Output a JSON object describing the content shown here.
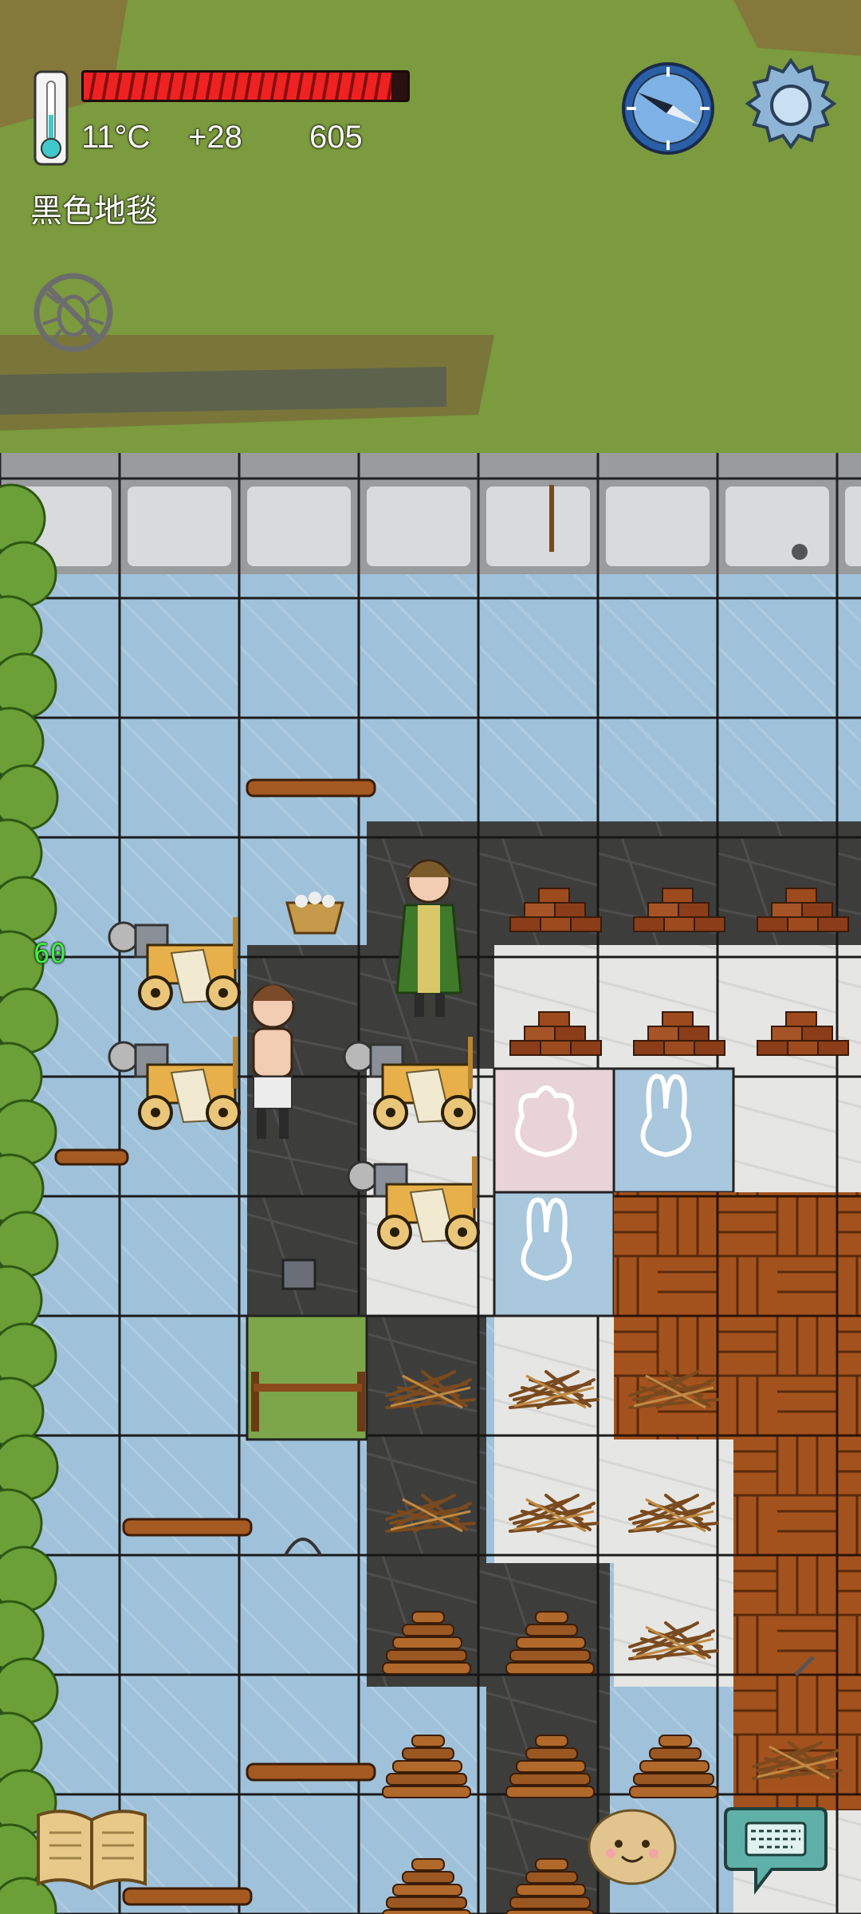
{
  "hud": {
    "health_fraction": 0.95,
    "temperature": "11°C",
    "food_bonus": "+28",
    "yum_count": "605",
    "held_item": "黑色地毯",
    "fps": "60"
  },
  "icons": {
    "thermometer": "thermometer-icon",
    "compass": "compass-icon",
    "settings": "gear-icon",
    "no_bugs": "no-mosquito-icon",
    "tech_book": "open-book-icon",
    "emote": "smiley-face-icon",
    "chat": "keyboard-speech-bubble-icon"
  },
  "colors": {
    "grass": "#6f8f3a",
    "stone_floor": "#cfd3d6",
    "blue_carpet": "#9fc0d8",
    "black_carpet": "#3a3a3a",
    "white_carpet": "#e4e4e4",
    "wood_floor": "#a4521d",
    "health": "#e22222",
    "fps": "#3df33d"
  }
}
